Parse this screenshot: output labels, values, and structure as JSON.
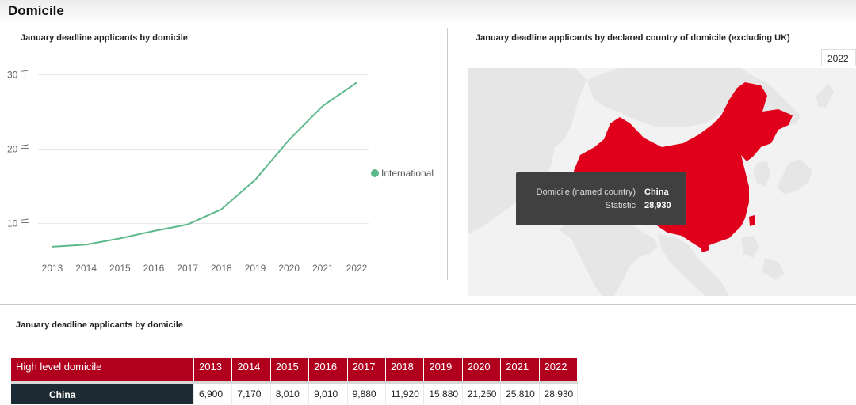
{
  "page": {
    "title": "Domicile"
  },
  "line_visual": {
    "title": "January deadline applicants by domicile"
  },
  "map_visual": {
    "title": "January deadline applicants by declared country of domicile (excluding UK)",
    "year_slicer": "2022",
    "highlight_country": "China",
    "tooltip": {
      "label1": "Domicile (named country)",
      "value1": "China",
      "label2": "Statistic",
      "value2": "28,930"
    },
    "colors": {
      "highlight": "#e0001b",
      "land": "#e6e6e6",
      "background": "#f2f2f2"
    }
  },
  "table_visual": {
    "title": "January deadline applicants by domicile",
    "header_label": "High level domicile",
    "years": [
      "2013",
      "2014",
      "2015",
      "2016",
      "2017",
      "2018",
      "2019",
      "2020",
      "2021",
      "2022"
    ],
    "rows": [
      {
        "name": "China",
        "values": [
          "6,900",
          "7,170",
          "8,010",
          "9,010",
          "9,880",
          "11,920",
          "15,880",
          "21,250",
          "25,810",
          "28,930"
        ]
      }
    ],
    "colors": {
      "header": "#b0001e",
      "rowhead": "#1e2a33"
    }
  },
  "chart_data": {
    "type": "line",
    "title": "",
    "xlabel": "",
    "ylabel": "",
    "x": [
      "2013",
      "2014",
      "2015",
      "2016",
      "2017",
      "2018",
      "2019",
      "2020",
      "2021",
      "2022"
    ],
    "series": [
      {
        "name": "International",
        "color": "#5cb98a",
        "values": [
          6900,
          7170,
          8010,
          9010,
          9880,
          11920,
          15880,
          21250,
          25810,
          28930
        ]
      }
    ],
    "yticks": [
      {
        "value": 10000,
        "label": "10 千"
      },
      {
        "value": 20000,
        "label": "20 千"
      },
      {
        "value": 30000,
        "label": "30 千"
      }
    ],
    "ylim": [
      5500,
      31000
    ],
    "grid": true,
    "legend_position": "right"
  }
}
